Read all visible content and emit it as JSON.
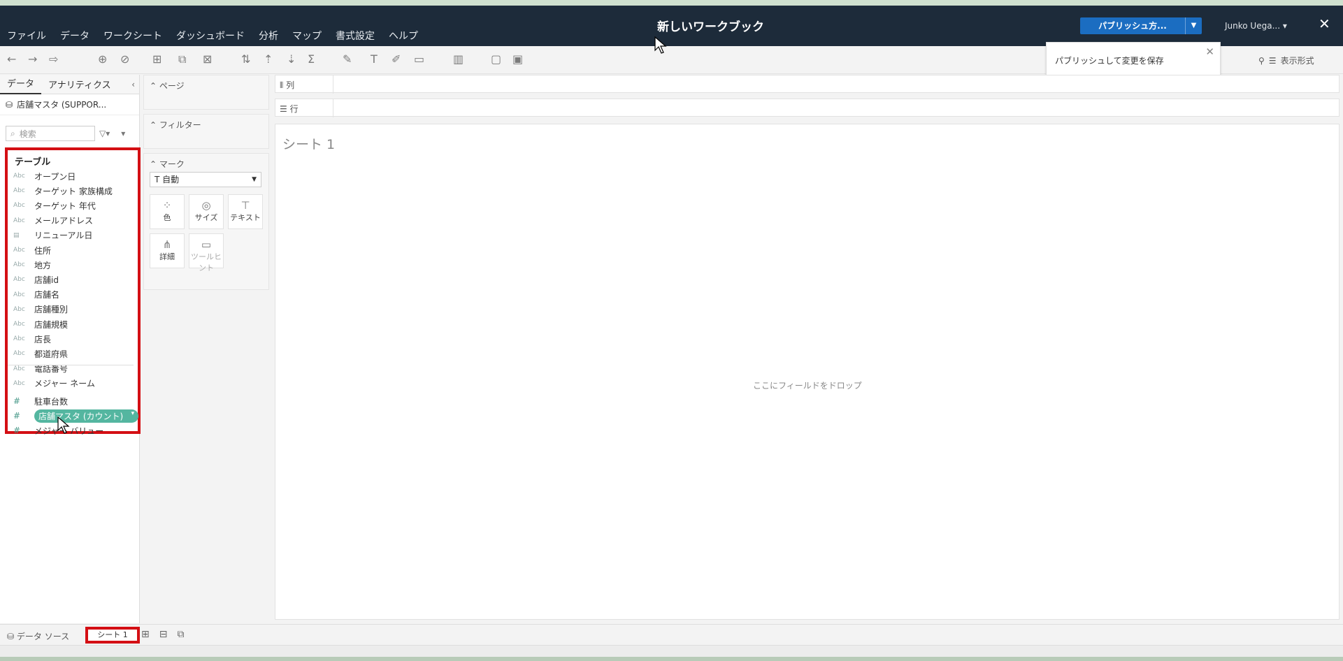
{
  "app": {
    "workbook_title": "新しいワークブック",
    "menu": [
      "ファイル",
      "データ",
      "ワークシート",
      "ダッシュボード",
      "分析",
      "マップ",
      "書式設定",
      "ヘルプ"
    ],
    "publish_label": "パブリッシュ方...",
    "user_name": "Junko Uega...",
    "tooltip_text": "パブリッシュして変更を保存",
    "format_label": "表示形式"
  },
  "left_pane": {
    "tabs": [
      "データ",
      "アナリティクス"
    ],
    "datasource": "店舗マスタ (SUPPOR...",
    "search_placeholder": "検索",
    "table_header": "テーブル",
    "dimensions": [
      {
        "type": "Abc",
        "name": "オープン日"
      },
      {
        "type": "Abc",
        "name": "ターゲット 家族構成"
      },
      {
        "type": "Abc",
        "name": "ターゲット 年代"
      },
      {
        "type": "Abc",
        "name": "メールアドレス"
      },
      {
        "type": "date",
        "name": "リニューアル日"
      },
      {
        "type": "Abc",
        "name": "住所"
      },
      {
        "type": "Abc",
        "name": "地方"
      },
      {
        "type": "Abc",
        "name": "店舗id"
      },
      {
        "type": "Abc",
        "name": "店舗名"
      },
      {
        "type": "Abc",
        "name": "店舗種別"
      },
      {
        "type": "Abc",
        "name": "店舗規模"
      },
      {
        "type": "Abc",
        "name": "店長"
      },
      {
        "type": "Abc",
        "name": "都道府県"
      },
      {
        "type": "Abc",
        "name": "電話番号"
      },
      {
        "type": "Abc",
        "name": "メジャー ネーム"
      }
    ],
    "measures": [
      {
        "type": "#",
        "name": "駐車台数"
      },
      {
        "type": "#",
        "name": "店舗マスタ (カウント)"
      },
      {
        "type": "#",
        "name": "メジャー バリュー"
      }
    ]
  },
  "shelves": {
    "pages": "ページ",
    "filters": "フィルター",
    "marks": "マーク",
    "mark_type": "自動",
    "mark_buttons": [
      "色",
      "サイズ",
      "テキスト",
      "詳細",
      "ツールヒント"
    ],
    "columns": "列",
    "rows": "行"
  },
  "canvas": {
    "sheet_title": "シート 1",
    "drop_hint": "ここにフィールドをドロップ"
  },
  "bottom": {
    "datasource_tab": "データ ソース",
    "sheet_tab": "シート 1"
  }
}
